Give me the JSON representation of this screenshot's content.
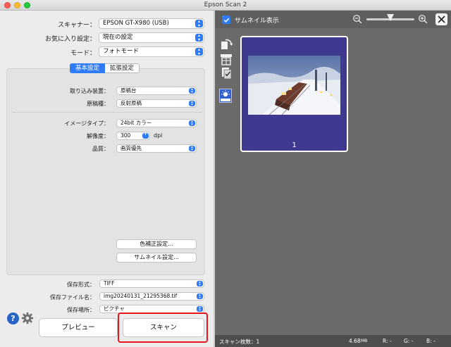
{
  "window": {
    "title": "Epson Scan 2"
  },
  "settings": {
    "scanner_label": "スキャナー：",
    "scanner_value": "EPSON GT-X980 (USB)",
    "favorites_label": "お気に入り設定：",
    "favorites_value": "現在の設定",
    "mode_label": "モード：",
    "mode_value": "フォトモード"
  },
  "tabs": {
    "basic": "基本設定",
    "advanced": "拡張設定"
  },
  "basic": {
    "source_label": "取り込み装置：",
    "source_value": "原稿台",
    "doc_type_label": "原稿種：",
    "doc_type_value": "反射原稿",
    "image_type_label": "イメージタイプ：",
    "image_type_value": "24bit カラー",
    "resolution_label": "解像度：",
    "resolution_value": "300",
    "resolution_unit": "dpi",
    "quality_label": "品質：",
    "quality_value": "画質優先",
    "color_correction_button": "色補正設定...",
    "thumbnail_settings_button": "サムネイル設定..."
  },
  "output": {
    "format_label": "保存形式：",
    "format_value": "TIFF",
    "filename_label": "保存ファイル名：",
    "filename_value": "img20240131_21295368.tif",
    "location_label": "保存場所：",
    "location_value": "ピクチャ"
  },
  "actions": {
    "help": "?",
    "preview": "プレビュー",
    "scan": "スキャン"
  },
  "preview_pane": {
    "thumbnail_toggle_label": "サムネイル表示",
    "thumbnail_toggle_checked": true,
    "thumbnail_number": "1",
    "icons": [
      "rotate-icon",
      "scan-area-icon",
      "document-settings-icon",
      "auto-exposure-icon"
    ]
  },
  "status": {
    "scan_count_label": "スキャン枚数：1",
    "size": "4.68",
    "size_unit": "MB",
    "r": "R:  -",
    "g": "G:  -",
    "b": "B:  -"
  },
  "colors": {
    "accent": "#2f7cf6",
    "highlight": "#e8161a",
    "thumb_bg": "#3f3a8f",
    "pane_bg": "#6b6b6b"
  }
}
